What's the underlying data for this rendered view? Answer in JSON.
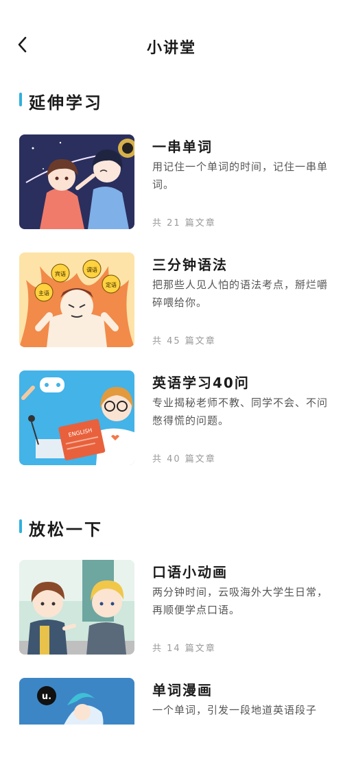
{
  "header": {
    "title": "小讲堂",
    "back_icon": "chevron-left-icon"
  },
  "sections": [
    {
      "title": "延伸学习",
      "items": [
        {
          "title": "一串单词",
          "desc": "用记住一个单词的时间，记住一串单词。",
          "count": "共 21 篇文章"
        },
        {
          "title": "三分钟语法",
          "desc": "把那些人见人怕的语法考点，掰烂嚼碎喂给你。",
          "count": "共 45 篇文章"
        },
        {
          "title": "英语学习40问",
          "desc": "专业揭秘老师不教、同学不会、不问憋得慌的问题。",
          "count": "共 40 篇文章"
        }
      ]
    },
    {
      "title": "放松一下",
      "items": [
        {
          "title": "口语小动画",
          "desc": "两分钟时间，云吸海外大学生日常，再顺便学点口语。",
          "count": "共 14 篇文章"
        },
        {
          "title": "单词漫画",
          "desc": "一个单词，引发一段地道英语段子",
          "count": ""
        }
      ]
    }
  ],
  "thumbnails": {
    "grammar_badges": [
      "主语",
      "宾语",
      "谓语",
      "定语"
    ],
    "book_label": "ENGLISH",
    "comic_badge": "u."
  },
  "colors": {
    "accent": "#2fb0dc",
    "text": "#1a1a1a",
    "muted": "#9a9a9a"
  }
}
